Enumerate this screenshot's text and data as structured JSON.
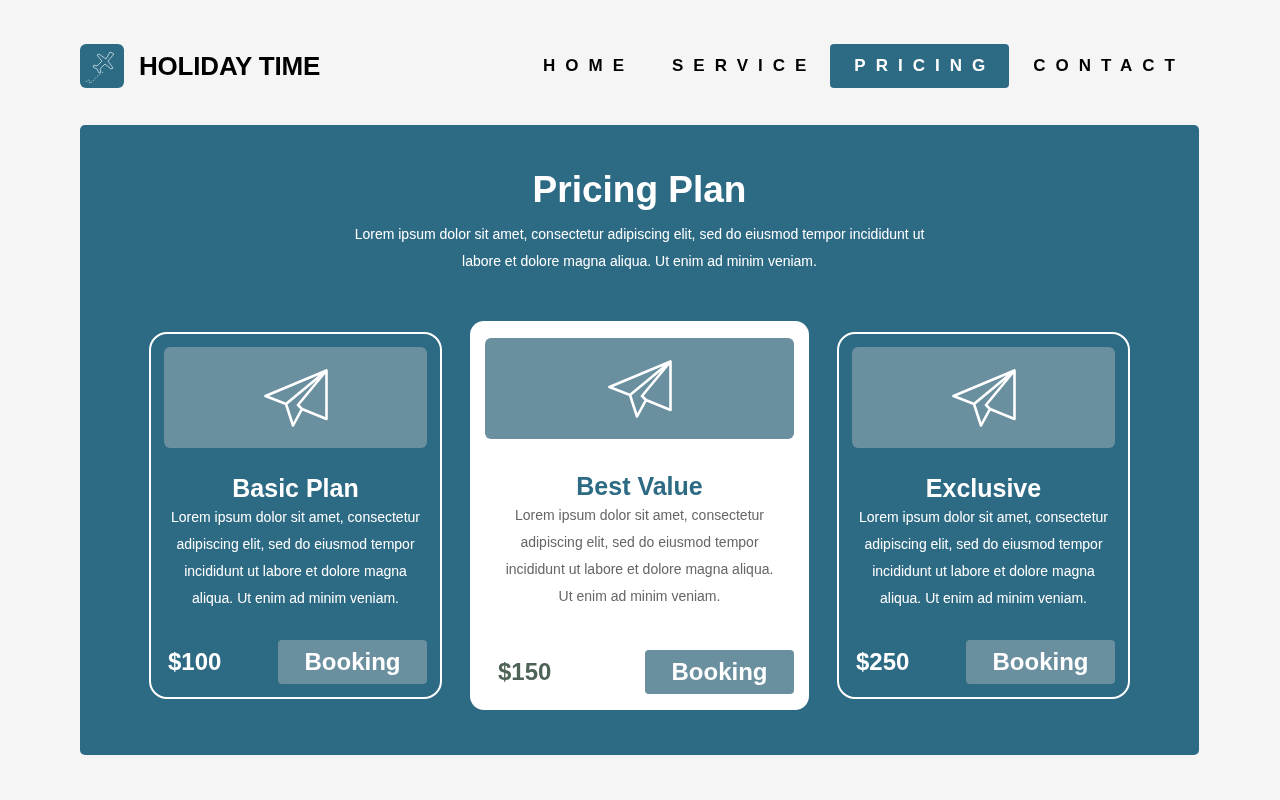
{
  "brand": {
    "name": "HOLIDAY TIME"
  },
  "nav": [
    {
      "label": "HOME",
      "selected": false
    },
    {
      "label": "SERVICE",
      "selected": false
    },
    {
      "label": "PRICING",
      "selected": true
    },
    {
      "label": "CONTACT",
      "selected": false
    }
  ],
  "pricing": {
    "title": "Pricing Plan",
    "subtitle": "Lorem ipsum dolor sit amet, consectetur adipiscing elit, sed do eiusmod tempor incididunt ut labore et dolore magna aliqua. Ut enim ad minim veniam.",
    "plans": [
      {
        "name": "Basic Plan",
        "description": "Lorem ipsum dolor sit amet, consectetur adipiscing elit, sed do eiusmod tempor incididunt ut labore et dolore magna aliqua. Ut enim ad minim veniam.",
        "price": "$100",
        "button": "Booking",
        "featured": false
      },
      {
        "name": "Best Value",
        "description": "Lorem ipsum dolor sit amet, consectetur adipiscing elit, sed do eiusmod tempor incididunt ut labore et dolore magna aliqua. Ut enim ad minim veniam.",
        "price": "$150",
        "button": "Booking",
        "featured": true
      },
      {
        "name": "Exclusive",
        "description": "Lorem ipsum dolor sit amet, consectetur adipiscing elit, sed do eiusmod tempor incididunt ut labore et dolore magna aliqua. Ut enim ad minim veniam.",
        "price": "$250",
        "button": "Booking",
        "featured": false
      }
    ]
  }
}
